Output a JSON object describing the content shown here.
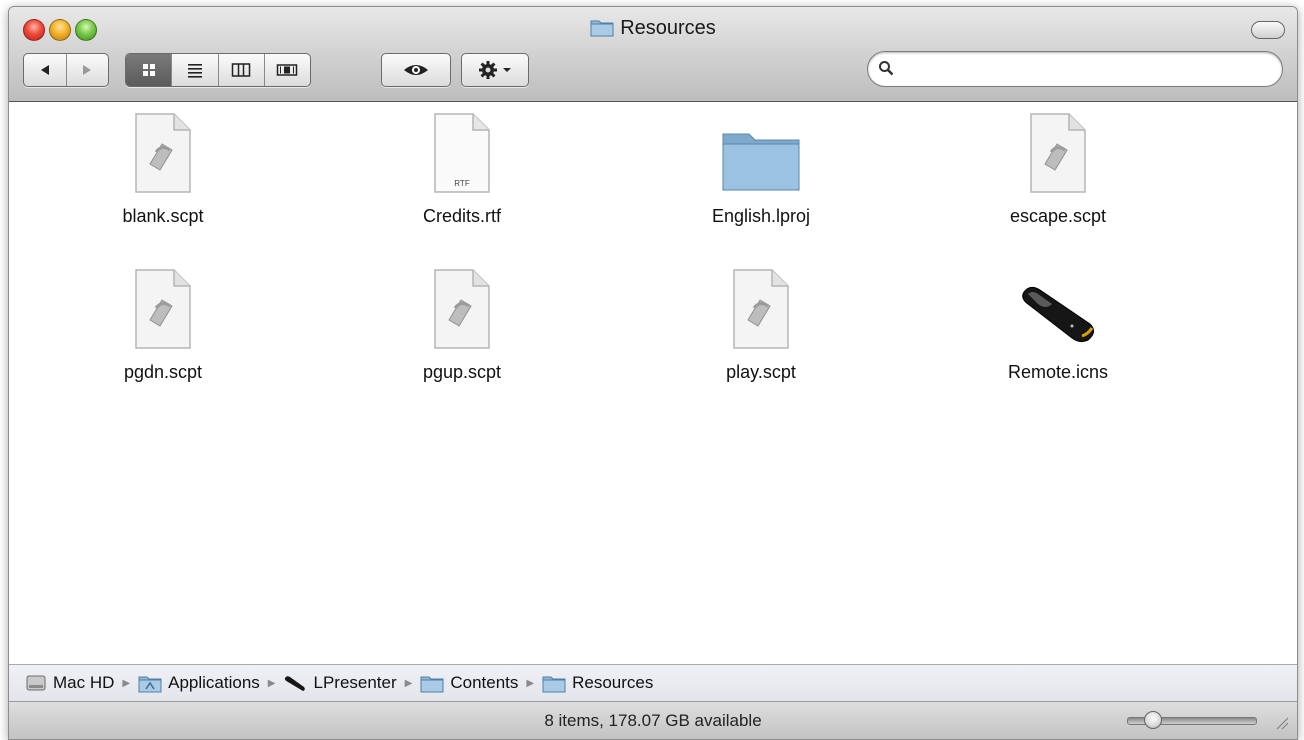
{
  "window": {
    "title": "Resources",
    "search": {
      "value": "",
      "placeholder": ""
    }
  },
  "toolbar": {
    "nav": [
      "back-arrow-icon",
      "forward-arrow-icon"
    ],
    "views": [
      "icon-view-icon",
      "list-view-icon",
      "column-view-icon",
      "coverflow-view-icon"
    ],
    "active_view": "icon-view",
    "quicklook": "eye-icon",
    "action": "gear-icon"
  },
  "files": [
    {
      "name": "blank.scpt",
      "icon": "applescript-icon"
    },
    {
      "name": "Credits.rtf",
      "icon": "rtf-document-icon",
      "badge": "RTF"
    },
    {
      "name": "English.lproj",
      "icon": "folder-icon"
    },
    {
      "name": "escape.scpt",
      "icon": "applescript-icon"
    },
    {
      "name": "pgdn.scpt",
      "icon": "applescript-icon"
    },
    {
      "name": "pgup.scpt",
      "icon": "applescript-icon"
    },
    {
      "name": "play.scpt",
      "icon": "applescript-icon"
    },
    {
      "name": "Remote.icns",
      "icon": "remote-control-icon"
    }
  ],
  "path": [
    {
      "label": "Mac HD",
      "icon": "hard-drive-icon"
    },
    {
      "label": "Applications",
      "icon": "applications-folder-icon"
    },
    {
      "label": "LPresenter",
      "icon": "remote-control-icon"
    },
    {
      "label": "Contents",
      "icon": "folder-icon"
    },
    {
      "label": "Resources",
      "icon": "folder-icon"
    }
  ],
  "status": {
    "text": "8 items, 178.07 GB available",
    "icon_size_fraction": 0.15
  },
  "colors": {
    "folder": "#8fb8d9",
    "active_segment": "#6a6a6a"
  }
}
